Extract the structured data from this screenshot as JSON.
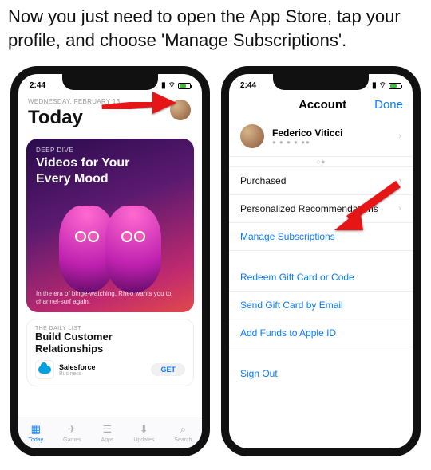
{
  "caption": "Now you just need to open the App Store, tap your profile, and choose 'Manage Subscriptions'.",
  "left": {
    "time": "2:44",
    "date_label": "WEDNESDAY, FEBRUARY 13",
    "page_title": "Today",
    "feature": {
      "eyebrow": "DEEP DIVE",
      "title_line1": "Videos for Your",
      "title_line2": "Every Mood",
      "caption": "In the era of binge-watching, Rheo wants you to channel-surf again."
    },
    "daily_list": {
      "eyebrow": "THE DAILY LIST",
      "title_line1": "Build Customer",
      "title_line2": "Relationships",
      "app_name": "Salesforce",
      "app_sub": "Business",
      "get_label": "GET"
    },
    "tabs": [
      "Today",
      "Games",
      "Apps",
      "Updates",
      "Search"
    ]
  },
  "right": {
    "time": "2:44",
    "nav_title": "Account",
    "done_label": "Done",
    "profile_name": "Federico Viticci",
    "profile_dots": "● ●  ● ● ●●",
    "page_dots": "○●",
    "rows": {
      "purchased": "Purchased",
      "recommendations": "Personalized Recommendations",
      "manage": "Manage Subscriptions",
      "redeem": "Redeem Gift Card or Code",
      "send_gift": "Send Gift Card by Email",
      "add_funds": "Add Funds to Apple ID",
      "sign_out": "Sign Out"
    }
  }
}
